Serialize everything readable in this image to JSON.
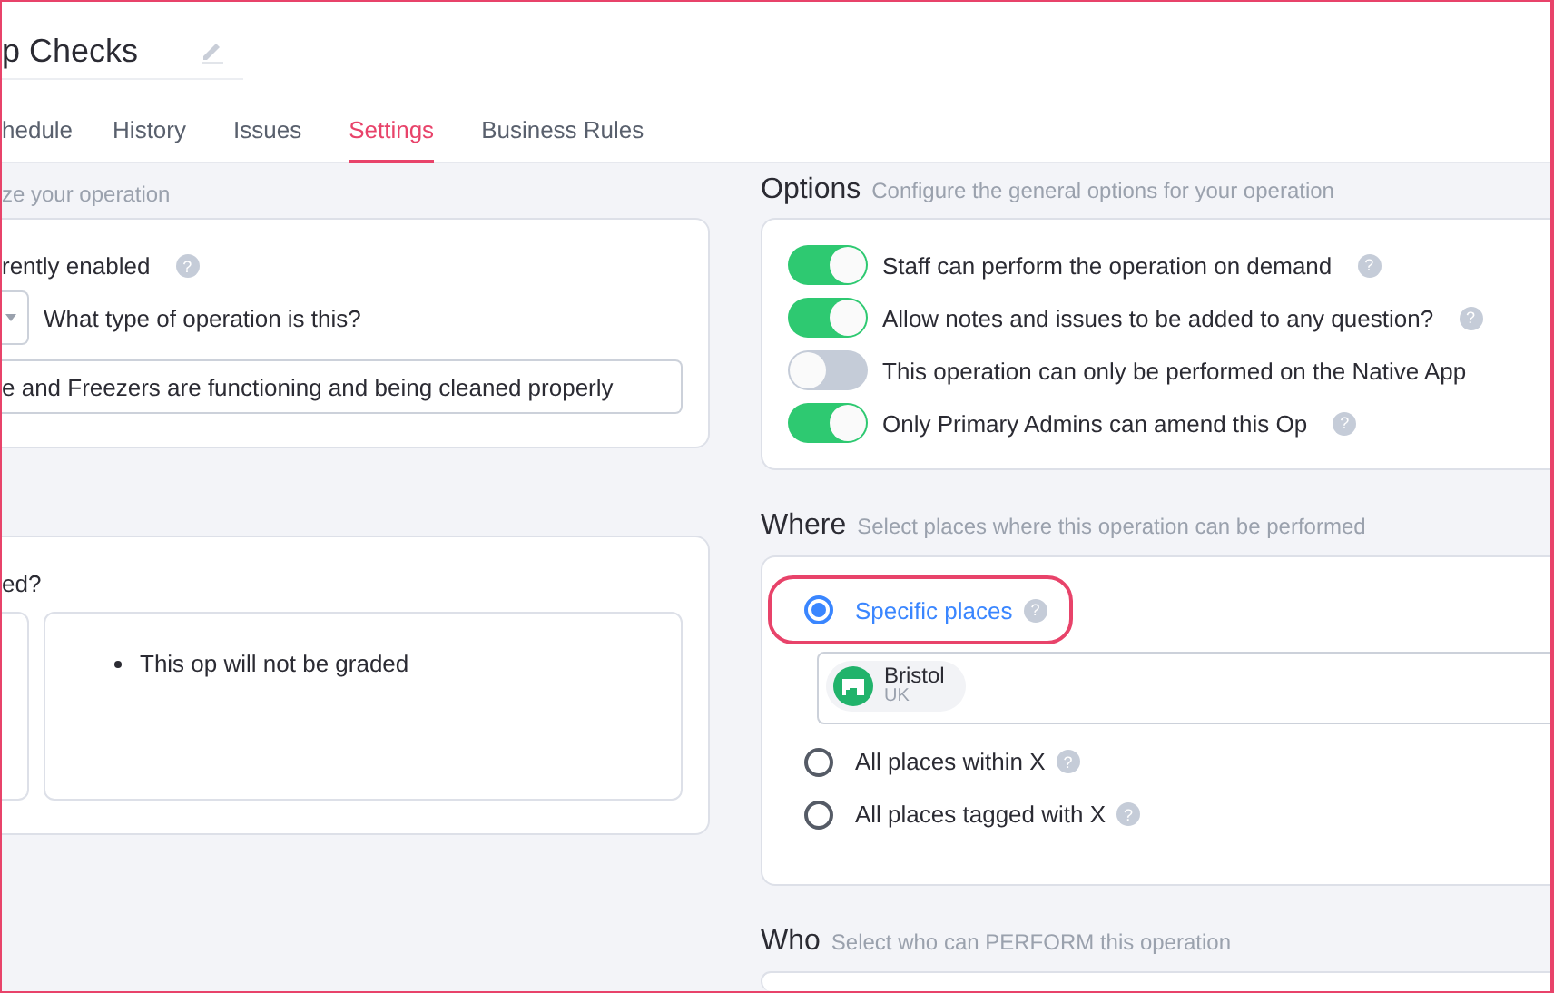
{
  "header": {
    "title": "p Checks"
  },
  "tabs": [
    {
      "label": "hedule",
      "selected": false
    },
    {
      "label": "History",
      "selected": false
    },
    {
      "label": "Issues",
      "selected": false
    },
    {
      "label": "Settings",
      "selected": true
    },
    {
      "label": "Business Rules",
      "selected": false
    }
  ],
  "general": {
    "subtitle": "ze your operation",
    "enabled_label": "rently enabled",
    "enabled_help": "?",
    "type_label": "What type of operation is this?",
    "description": "e and Freezers are functioning and being cleaned properly"
  },
  "grading": {
    "question": "ed?",
    "notes": [
      "This op will not be graded"
    ]
  },
  "options": {
    "title": "Options",
    "subtitle": "Configure the general options for your operation",
    "items": [
      {
        "label": "Staff can perform the operation on demand",
        "on": true,
        "help": "?"
      },
      {
        "label": "Allow notes and issues to be added to any question?",
        "on": true,
        "help": "?"
      },
      {
        "label": "This operation can only be performed on the Native App",
        "on": false
      },
      {
        "label": "Only Primary Admins can amend this Op",
        "on": true,
        "help": "?"
      }
    ]
  },
  "where": {
    "title": "Where",
    "subtitle": "Select places where this operation can be performed",
    "choices": [
      {
        "label": "Specific places",
        "selected": true,
        "help": "?",
        "places": [
          {
            "name": "Bristol",
            "country": "UK"
          }
        ]
      },
      {
        "label": "All places within X",
        "selected": false,
        "help": "?"
      },
      {
        "label": "All places tagged with X",
        "selected": false,
        "help": "?"
      }
    ]
  },
  "who": {
    "title": "Who",
    "subtitle": "Select who can PERFORM this operation"
  }
}
